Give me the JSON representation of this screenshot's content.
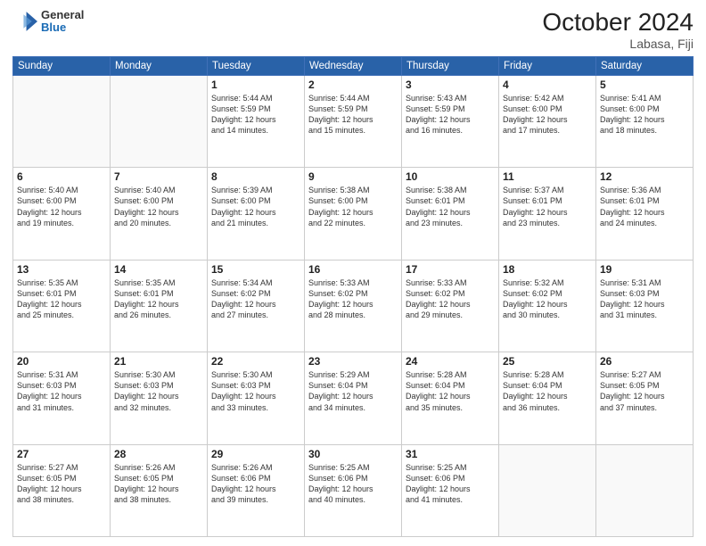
{
  "header": {
    "logo": {
      "general": "General",
      "blue": "Blue"
    },
    "title": "October 2024",
    "location": "Labasa, Fiji"
  },
  "days_header": [
    "Sunday",
    "Monday",
    "Tuesday",
    "Wednesday",
    "Thursday",
    "Friday",
    "Saturday"
  ],
  "weeks": [
    [
      {
        "num": "",
        "info": ""
      },
      {
        "num": "",
        "info": ""
      },
      {
        "num": "1",
        "info": "Sunrise: 5:44 AM\nSunset: 5:59 PM\nDaylight: 12 hours\nand 14 minutes."
      },
      {
        "num": "2",
        "info": "Sunrise: 5:44 AM\nSunset: 5:59 PM\nDaylight: 12 hours\nand 15 minutes."
      },
      {
        "num": "3",
        "info": "Sunrise: 5:43 AM\nSunset: 5:59 PM\nDaylight: 12 hours\nand 16 minutes."
      },
      {
        "num": "4",
        "info": "Sunrise: 5:42 AM\nSunset: 6:00 PM\nDaylight: 12 hours\nand 17 minutes."
      },
      {
        "num": "5",
        "info": "Sunrise: 5:41 AM\nSunset: 6:00 PM\nDaylight: 12 hours\nand 18 minutes."
      }
    ],
    [
      {
        "num": "6",
        "info": "Sunrise: 5:40 AM\nSunset: 6:00 PM\nDaylight: 12 hours\nand 19 minutes."
      },
      {
        "num": "7",
        "info": "Sunrise: 5:40 AM\nSunset: 6:00 PM\nDaylight: 12 hours\nand 20 minutes."
      },
      {
        "num": "8",
        "info": "Sunrise: 5:39 AM\nSunset: 6:00 PM\nDaylight: 12 hours\nand 21 minutes."
      },
      {
        "num": "9",
        "info": "Sunrise: 5:38 AM\nSunset: 6:00 PM\nDaylight: 12 hours\nand 22 minutes."
      },
      {
        "num": "10",
        "info": "Sunrise: 5:38 AM\nSunset: 6:01 PM\nDaylight: 12 hours\nand 23 minutes."
      },
      {
        "num": "11",
        "info": "Sunrise: 5:37 AM\nSunset: 6:01 PM\nDaylight: 12 hours\nand 23 minutes."
      },
      {
        "num": "12",
        "info": "Sunrise: 5:36 AM\nSunset: 6:01 PM\nDaylight: 12 hours\nand 24 minutes."
      }
    ],
    [
      {
        "num": "13",
        "info": "Sunrise: 5:35 AM\nSunset: 6:01 PM\nDaylight: 12 hours\nand 25 minutes."
      },
      {
        "num": "14",
        "info": "Sunrise: 5:35 AM\nSunset: 6:01 PM\nDaylight: 12 hours\nand 26 minutes."
      },
      {
        "num": "15",
        "info": "Sunrise: 5:34 AM\nSunset: 6:02 PM\nDaylight: 12 hours\nand 27 minutes."
      },
      {
        "num": "16",
        "info": "Sunrise: 5:33 AM\nSunset: 6:02 PM\nDaylight: 12 hours\nand 28 minutes."
      },
      {
        "num": "17",
        "info": "Sunrise: 5:33 AM\nSunset: 6:02 PM\nDaylight: 12 hours\nand 29 minutes."
      },
      {
        "num": "18",
        "info": "Sunrise: 5:32 AM\nSunset: 6:02 PM\nDaylight: 12 hours\nand 30 minutes."
      },
      {
        "num": "19",
        "info": "Sunrise: 5:31 AM\nSunset: 6:03 PM\nDaylight: 12 hours\nand 31 minutes."
      }
    ],
    [
      {
        "num": "20",
        "info": "Sunrise: 5:31 AM\nSunset: 6:03 PM\nDaylight: 12 hours\nand 31 minutes."
      },
      {
        "num": "21",
        "info": "Sunrise: 5:30 AM\nSunset: 6:03 PM\nDaylight: 12 hours\nand 32 minutes."
      },
      {
        "num": "22",
        "info": "Sunrise: 5:30 AM\nSunset: 6:03 PM\nDaylight: 12 hours\nand 33 minutes."
      },
      {
        "num": "23",
        "info": "Sunrise: 5:29 AM\nSunset: 6:04 PM\nDaylight: 12 hours\nand 34 minutes."
      },
      {
        "num": "24",
        "info": "Sunrise: 5:28 AM\nSunset: 6:04 PM\nDaylight: 12 hours\nand 35 minutes."
      },
      {
        "num": "25",
        "info": "Sunrise: 5:28 AM\nSunset: 6:04 PM\nDaylight: 12 hours\nand 36 minutes."
      },
      {
        "num": "26",
        "info": "Sunrise: 5:27 AM\nSunset: 6:05 PM\nDaylight: 12 hours\nand 37 minutes."
      }
    ],
    [
      {
        "num": "27",
        "info": "Sunrise: 5:27 AM\nSunset: 6:05 PM\nDaylight: 12 hours\nand 38 minutes."
      },
      {
        "num": "28",
        "info": "Sunrise: 5:26 AM\nSunset: 6:05 PM\nDaylight: 12 hours\nand 38 minutes."
      },
      {
        "num": "29",
        "info": "Sunrise: 5:26 AM\nSunset: 6:06 PM\nDaylight: 12 hours\nand 39 minutes."
      },
      {
        "num": "30",
        "info": "Sunrise: 5:25 AM\nSunset: 6:06 PM\nDaylight: 12 hours\nand 40 minutes."
      },
      {
        "num": "31",
        "info": "Sunrise: 5:25 AM\nSunset: 6:06 PM\nDaylight: 12 hours\nand 41 minutes."
      },
      {
        "num": "",
        "info": ""
      },
      {
        "num": "",
        "info": ""
      }
    ]
  ]
}
